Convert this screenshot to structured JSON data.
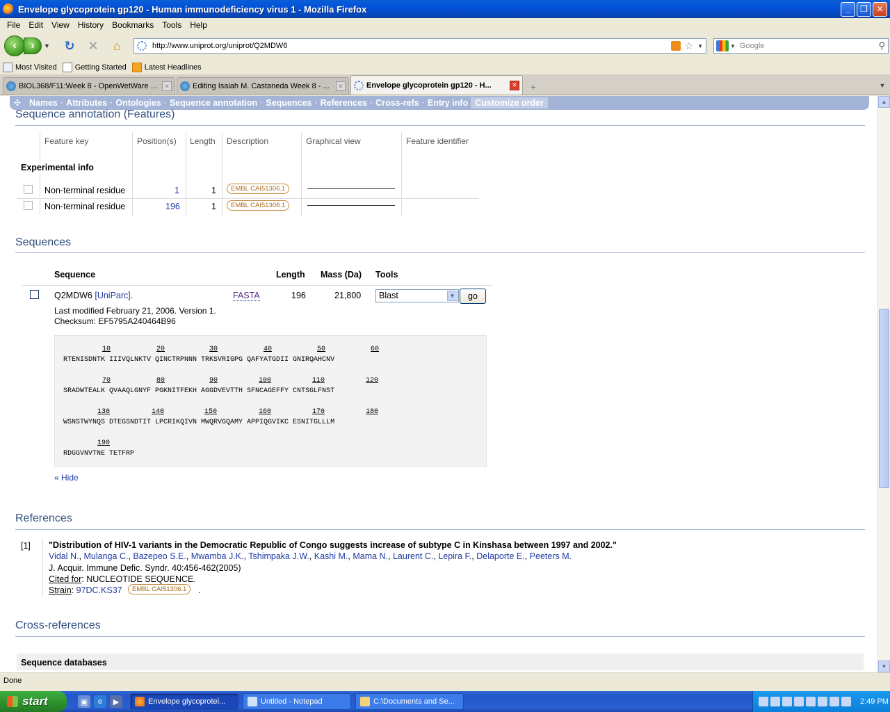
{
  "window": {
    "title": "Envelope glycoprotein gp120 - Human immunodeficiency virus 1 - Mozilla Firefox"
  },
  "menu": [
    "File",
    "Edit",
    "View",
    "History",
    "Bookmarks",
    "Tools",
    "Help"
  ],
  "nav": {
    "url": "http://www.uniprot.org/uniprot/Q2MDW6",
    "search_placeholder": "Google"
  },
  "bookmarks": [
    "Most Visited",
    "Getting Started",
    "Latest Headlines"
  ],
  "tabs": [
    {
      "label": "BIOL368/F11:Week 8 - OpenWetWare ..."
    },
    {
      "label": "Editing Isaiah M. Castaneda Week 8 - ..."
    },
    {
      "label": "Envelope glycoprotein gp120 - H..."
    }
  ],
  "section_nav": [
    "Names",
    "Attributes",
    "Ontologies",
    "Sequence annotation",
    "Sequences",
    "References",
    "Cross-refs",
    "Entry info",
    "Customize order"
  ],
  "features": {
    "heading": "Sequence annotation (Features)",
    "columns": [
      "Feature key",
      "Position(s)",
      "Length",
      "Description",
      "Graphical view",
      "Feature identifier"
    ],
    "group_label": "Experimental info",
    "rows": [
      {
        "key": "Non-terminal residue",
        "position": "1",
        "length": "1",
        "evidence": "EMBL CAI51306.1"
      },
      {
        "key": "Non-terminal residue",
        "position": "196",
        "length": "1",
        "evidence": "EMBL CAI51306.1"
      }
    ]
  },
  "sequences": {
    "heading": "Sequences",
    "columns": [
      "Sequence",
      "Length",
      "Mass (Da)",
      "Tools"
    ],
    "entry": {
      "accession": "Q2MDW6",
      "uniparc": "[UniParc]",
      "uniparc_suffix": ".",
      "fasta": "FASTA",
      "length": "196",
      "mass": "21,800",
      "tool_selected": "Blast",
      "go_label": "go",
      "modified": "Last modified February 21, 2006. Version 1.",
      "checksum": "Checksum: EF5795A240464B96"
    },
    "blocks": [
      {
        "nums": [
          "10",
          "20",
          "30",
          "40",
          "50",
          "60"
        ],
        "line": "RTENISDNTK IIIVQLNKTV QINCTRPNNN TRKSVRIGPG QAFYATGDII GNIRQAHCNV"
      },
      {
        "nums": [
          "70",
          "80",
          "90",
          "100",
          "110",
          "120"
        ],
        "line": "SRADWTEALK QVAAQLGNYF PGKNITFEKH AGGDVEVTTH SFNCAGEFFY CNTSGLFNST"
      },
      {
        "nums": [
          "130",
          "140",
          "150",
          "160",
          "170",
          "180"
        ],
        "line": "WSNSTWYNQS DTEGSNDTIT LPCRIKQIVN MWQRVGQAMY APPIQGVIKC ESNITGLLLM"
      },
      {
        "nums": [
          "190"
        ],
        "line": "RDGGVNVTNE TETFRP"
      }
    ],
    "hide_label": "« Hide"
  },
  "references": {
    "heading": "References",
    "items": [
      {
        "index": "[1]",
        "title": "\"Distribution of HIV-1 variants in the Democratic Republic of Congo suggests increase of subtype C in Kinshasa between 1997 and 2002.\"",
        "authors": [
          "Vidal N.",
          "Mulanga C.",
          "Bazepeo S.E.",
          "Mwamba J.K.",
          "Tshimpaka J.W.",
          "Kashi M.",
          "Mama N.",
          "Laurent C.",
          "Lepira F.",
          "Delaporte E.",
          "Peeters M."
        ],
        "journal": "J. Acquir. Immune Defic. Syndr. 40:456-462(2005)",
        "cited_label": "Cited for",
        "cited_value": ": NUCLEOTIDE SEQUENCE.",
        "strain_label": "Strain",
        "strain_colon": ":",
        "strain_value": "97DC.KS37",
        "strain_evidence": "EMBL CAI51306.1",
        "strain_suffix": "."
      }
    ]
  },
  "crossrefs": {
    "heading": "Cross-references",
    "subheading": "Sequence databases"
  },
  "status": "Done",
  "taskbar": {
    "start": "start",
    "items": [
      "Envelope glycoprotei...",
      "Untitled - Notepad",
      "C:\\Documents and Se..."
    ],
    "clock": "2:49 PM"
  }
}
